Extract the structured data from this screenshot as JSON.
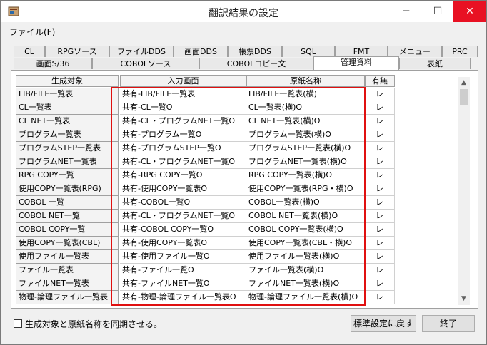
{
  "window": {
    "title": "翻訳結果の設定"
  },
  "menu": {
    "file": "ファイル(F)"
  },
  "titlebar_buttons": {
    "min": "─",
    "max": "☐",
    "close": "✕"
  },
  "tabs_top": [
    "CL",
    "RPGソース",
    "ファイルDDS",
    "画面DDS",
    "帳票DDS",
    "SQL",
    "FMT",
    "メニュー",
    "PRC"
  ],
  "tabs_bottom": [
    "画面S/36",
    "COBOLソース",
    "COBOLコピー文",
    "管理資料",
    "表紙"
  ],
  "active_tab": "管理資料",
  "columns": [
    "生成対象",
    "入力画面",
    "原紙名称",
    "有無"
  ],
  "rows": [
    [
      "LIB/FILE一覧表",
      "共有-LIB/FILE一覧表",
      "LIB/FILE一覧表(横)",
      "レ"
    ],
    [
      "CL一覧表",
      "共有-CL一覧O",
      "CL一覧表(横)O",
      "レ"
    ],
    [
      "CL NET一覧表",
      "共有-CL・プログラムNET一覧O",
      "CL NET一覧表(横)O",
      "レ"
    ],
    [
      "プログラム一覧表",
      "共有-プログラム一覧O",
      "プログラム一覧表(横)O",
      "レ"
    ],
    [
      "プログラムSTEP一覧表",
      "共有-プログラムSTEP一覧O",
      "プログラムSTEP一覧表(横)O",
      "レ"
    ],
    [
      "プログラムNET一覧表",
      "共有-CL・プログラムNET一覧O",
      "プログラムNET一覧表(横)O",
      "レ"
    ],
    [
      "RPG COPY一覧",
      "共有-RPG COPY一覧O",
      "RPG COPY一覧表(横)O",
      "レ"
    ],
    [
      "使用COPY一覧表(RPG)",
      "共有-使用COPY一覧表O",
      "使用COPY一覧表(RPG・横)O",
      "レ"
    ],
    [
      "COBOL 一覧",
      "共有-COBOL一覧O",
      "COBOL一覧表(横)O",
      "レ"
    ],
    [
      "COBOL NET一覧",
      "共有-CL・プログラムNET一覧O",
      "COBOL NET一覧表(横)O",
      "レ"
    ],
    [
      "COBOL COPY一覧",
      "共有-COBOL COPY一覧O",
      "COBOL COPY一覧表(横)O",
      "レ"
    ],
    [
      "使用COPY一覧表(CBL)",
      "共有-使用COPY一覧表O",
      "使用COPY一覧表(CBL・横)O",
      "レ"
    ],
    [
      "使用ファイル一覧表",
      "共有-使用ファイル一覧O",
      "使用ファイル一覧表(横)O",
      "レ"
    ],
    [
      "ファイル一覧表",
      "共有-ファイル一覧O",
      "ファイル一覧表(横)O",
      "レ"
    ],
    [
      "ファイルNET一覧表",
      "共有-ファイルNET一覧O",
      "ファイルNET一覧表(横)O",
      "レ"
    ],
    [
      "物理-論理ファイル一覧表",
      "共有-物理-論理ファイル一覧表O",
      "物理-論理ファイル一覧表(横)O",
      "レ"
    ]
  ],
  "footer": {
    "sync_checkbox_label": "生成対象と原紙名称を同期させる。",
    "sync_checked": false,
    "reset_button": "標準設定に戻す",
    "close_button": "終了"
  },
  "scroll": {
    "up": "▲",
    "down": "▼"
  },
  "colors": {
    "highlight": "#e01010",
    "close_button": "#e81123"
  }
}
